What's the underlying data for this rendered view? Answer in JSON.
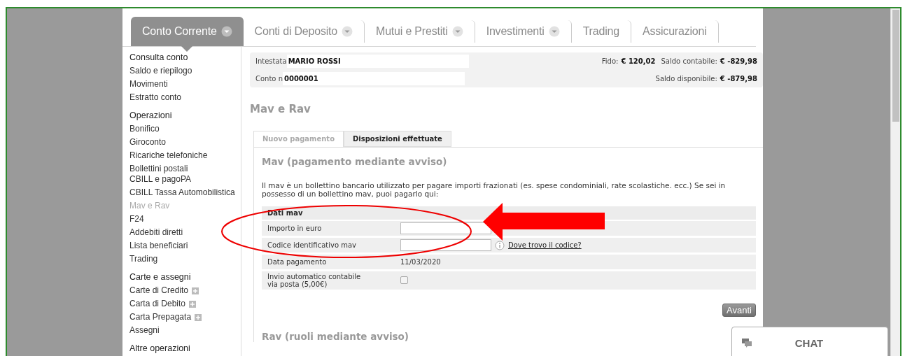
{
  "nav_tabs": [
    {
      "label": "Conto Corrente",
      "selected": true,
      "dropdown": true
    },
    {
      "label": "Conti di Deposito",
      "selected": false,
      "dropdown": true
    },
    {
      "label": "Mutui e Prestiti",
      "selected": false,
      "dropdown": true
    },
    {
      "label": "Investimenti",
      "selected": false,
      "dropdown": true
    },
    {
      "label": "Trading",
      "selected": false,
      "dropdown": false
    },
    {
      "label": "Assicurazioni",
      "selected": false,
      "dropdown": false
    }
  ],
  "sidebar": {
    "groups": [
      {
        "title": "Consulta conto",
        "items": [
          {
            "label": "Saldo e riepilogo",
            "selected": false,
            "expandable": false
          },
          {
            "label": "Movimenti",
            "selected": false,
            "expandable": false
          },
          {
            "label": "Estratto conto",
            "selected": false,
            "expandable": false
          }
        ]
      },
      {
        "title": "Operazioni",
        "items": [
          {
            "label": "Bonifico",
            "selected": false,
            "expandable": false
          },
          {
            "label": "Giroconto",
            "selected": false,
            "expandable": false
          },
          {
            "label": "Ricariche telefoniche",
            "selected": false,
            "expandable": false
          },
          {
            "label": "Bollettini postali\nCBILL e pagoPA",
            "selected": false,
            "expandable": false
          },
          {
            "label": "CBILL Tassa Automobilistica",
            "selected": false,
            "expandable": false
          },
          {
            "label": "Mav e Rav",
            "selected": true,
            "expandable": false
          },
          {
            "label": "F24",
            "selected": false,
            "expandable": false
          },
          {
            "label": "Addebiti diretti",
            "selected": false,
            "expandable": false
          },
          {
            "label": "Lista beneficiari",
            "selected": false,
            "expandable": false
          },
          {
            "label": "Trading",
            "selected": false,
            "expandable": false
          }
        ]
      },
      {
        "title": "Carte e assegni",
        "items": [
          {
            "label": "Carte di Credito",
            "selected": false,
            "expandable": true
          },
          {
            "label": "Carta di Debito",
            "selected": false,
            "expandable": true
          },
          {
            "label": "Carta Prepagata",
            "selected": false,
            "expandable": true
          },
          {
            "label": "Assegni",
            "selected": false,
            "expandable": false
          }
        ]
      },
      {
        "title": "Altre operazioni"
      }
    ]
  },
  "account": {
    "holder_label": "Intestata",
    "holder": "MARIO ROSSI",
    "number_label": "Conto n",
    "number": "0000001",
    "fido_label": "Fido:",
    "fido": "€ 120,02",
    "saldo_contabile_label": "Saldo contabile:",
    "saldo_contabile": "€ -829,98",
    "saldo_disponibile_label": "Saldo disponibile:",
    "saldo_disponibile": "€ -879,98"
  },
  "page_title": "Mav e Rav",
  "content_tabs": [
    {
      "label": "Nuovo pagamento",
      "selected": true
    },
    {
      "label": "Disposizioni effettuate",
      "selected": false
    }
  ],
  "mav": {
    "title": "Mav (pagamento mediante avviso)",
    "description": "Il mav è un bollettino bancario utilizzato per pagare importi frazionati (es. spese condominiali, rate scolastiche. ecc.) Se sei in possesso di un bollettino mav, puoi pagarlo qui:",
    "form_title": "Dati mav",
    "rows": [
      {
        "kind": "input",
        "label": "Importo in euro"
      },
      {
        "kind": "input_help",
        "label": "Codice identificativo mav",
        "link": "Dove trovo il codice?"
      },
      {
        "kind": "text",
        "label": "Data pagamento",
        "value": "11/03/2020"
      },
      {
        "kind": "checkbox",
        "label": "Invio automatico contabile via posta (5,00€)",
        "checked": false
      }
    ],
    "button": "Avanti"
  },
  "rav": {
    "title": "Rav (ruoli mediante avviso)"
  },
  "chat": {
    "label": "CHAT"
  }
}
